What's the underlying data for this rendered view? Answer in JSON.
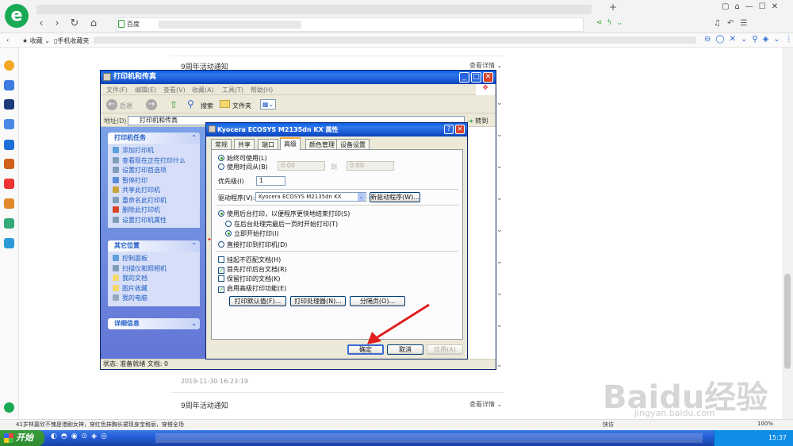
{
  "browser": {
    "address": "百度",
    "favorites": [
      "收藏",
      "手机收藏夹"
    ]
  },
  "page": {
    "news1_title": "9周年活动通知",
    "news1_more": "查看详情",
    "timestamp": "2019-11-30 16:23:19",
    "news2_title": "9周年活动通知",
    "news2_more": "查看详情",
    "watermark": "Baidu经验",
    "watermark_url": "jingyan.baidu.com"
  },
  "status": {
    "ticker": "41岁林嘉欣不愧是港剧女神，穿红色抹胸长裙现身宝格丽，穿搭全场",
    "speed": "快访",
    "zoom": "100%"
  },
  "taskbar": {
    "start": "开始",
    "time": "15:37"
  },
  "explorer": {
    "title": "打印机和传真",
    "menus": [
      "文件(F)",
      "编辑(E)",
      "查看(V)",
      "收藏(A)",
      "工具(T)",
      "帮助(H)"
    ],
    "back": "后退",
    "search": "搜索",
    "folders": "文件夹",
    "address_label": "地址(D)",
    "address_value": "打印机和传真",
    "go": "转到",
    "tasks_header": "打印机任务",
    "tasks": [
      "添加打印机",
      "查看现在正在打印什么",
      "设置打印首选项",
      "暂停打印",
      "共享此打印机",
      "重命名此打印机",
      "删除此打印机",
      "设置打印机属性"
    ],
    "other_header": "其它位置",
    "other": [
      "控制面板",
      "扫描仪和照相机",
      "我的文档",
      "图片收藏",
      "我的电脑"
    ],
    "detail_header": "详细信息",
    "status_text": "状态: 准备就绪 文档: 0"
  },
  "dialog": {
    "title": "Kyocera ECOSYS M2135dn KX 属性",
    "tabs": [
      "常规",
      "共享",
      "端口",
      "高级",
      "颜色管理",
      "设备设置"
    ],
    "always": "始终可使用(L)",
    "from": "使用时间从(B)",
    "time_from": "0:00",
    "to": "到",
    "time_to": "0:00",
    "priority_label": "优先级(I)",
    "priority": "1",
    "driver_label": "驱动程序(V):",
    "driver": "Kyocera ECOSYS M2135dn KX",
    "new_driver": "新驱动程序(W)...",
    "spool": "使用后台打印，以便程序更快地结束打印(S)",
    "spool_after": "在后台处理完最后一页时开始打印(T)",
    "spool_now": "立即开始打印(I)",
    "direct": "直接打印到打印机(D)",
    "hold": "挂起不匹配文档(H)",
    "first": "首先打印后台文档(R)",
    "keep": "保留打印的文档(K)",
    "advanced": "启用高级打印功能(E)",
    "btn_defaults": "打印默认值(F)...",
    "btn_processor": "打印处理器(N)...",
    "btn_separator": "分隔页(O)...",
    "ok": "确定",
    "cancel": "取消",
    "apply": "应用(A)"
  }
}
